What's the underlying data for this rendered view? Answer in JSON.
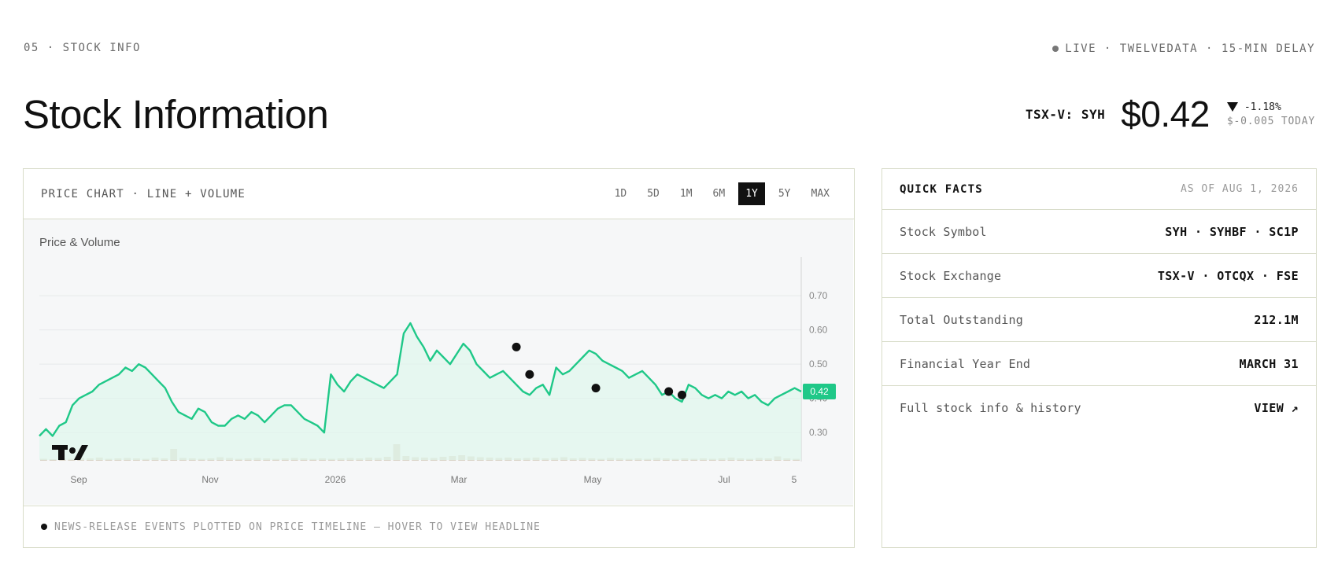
{
  "header": {
    "section_label": "05 · STOCK INFO",
    "live_status": "LIVE · TWELVEDATA · 15-MIN DELAY",
    "title": "Stock Information"
  },
  "quote": {
    "ticker": "TSX-V: SYH",
    "price": "$0.42",
    "change_pct": "-1.18%",
    "change_today": "$-0.005 TODAY"
  },
  "chart_panel": {
    "label": "PRICE CHART · LINE + VOLUME",
    "tabs": [
      "1D",
      "5D",
      "1M",
      "6M",
      "1Y",
      "5Y",
      "MAX"
    ],
    "active_tab": "1Y",
    "footer_note": "NEWS-RELEASE EVENTS PLOTTED ON PRICE TIMELINE — HOVER TO VIEW HEADLINE"
  },
  "chart_data": {
    "type": "line",
    "title": "Price & Volume",
    "x_ticks": [
      "Sep",
      "Nov",
      "2026",
      "Mar",
      "May",
      "Jul",
      "5"
    ],
    "y_ticks": [
      0.3,
      0.4,
      0.5,
      0.6,
      0.7
    ],
    "ylim": [
      0.22,
      0.79
    ],
    "last_price_label": "0.42",
    "series": [
      {
        "values": [
          0.29,
          0.31,
          0.29,
          0.32,
          0.33,
          0.38,
          0.4,
          0.41,
          0.42,
          0.44,
          0.45,
          0.46,
          0.47,
          0.49,
          0.48,
          0.5,
          0.49,
          0.47,
          0.45,
          0.43,
          0.39,
          0.36,
          0.35,
          0.34,
          0.37,
          0.36,
          0.33,
          0.32,
          0.32,
          0.34,
          0.35,
          0.34,
          0.36,
          0.35,
          0.33,
          0.35,
          0.37,
          0.38,
          0.38,
          0.36,
          0.34,
          0.33,
          0.32,
          0.3,
          0.47,
          0.44,
          0.42,
          0.45,
          0.47,
          0.46,
          0.45,
          0.44,
          0.43,
          0.45,
          0.47,
          0.59,
          0.62,
          0.58,
          0.55,
          0.51,
          0.54,
          0.52,
          0.5,
          0.53,
          0.56,
          0.54,
          0.5,
          0.48,
          0.46,
          0.47,
          0.48,
          0.46,
          0.44,
          0.42,
          0.41,
          0.43,
          0.44,
          0.41,
          0.49,
          0.47,
          0.48,
          0.5,
          0.52,
          0.54,
          0.53,
          0.51,
          0.5,
          0.49,
          0.48,
          0.46,
          0.47,
          0.48,
          0.46,
          0.44,
          0.41,
          0.42,
          0.4,
          0.39,
          0.44,
          0.43,
          0.41,
          0.4,
          0.41,
          0.4,
          0.42,
          0.41,
          0.42,
          0.4,
          0.41,
          0.39,
          0.38,
          0.4,
          0.41,
          0.42,
          0.43,
          0.42
        ]
      },
      {
        "name": "Volume",
        "values": [
          0.5,
          0.4,
          0.6,
          0.5,
          0.7,
          0.6,
          0.8,
          0.5,
          0.6,
          0.7,
          0.6,
          0.5,
          0.8,
          0.6,
          3.0,
          0.7,
          0.6,
          0.5,
          0.6,
          0.9,
          0.7,
          0.5,
          0.6,
          0.7,
          0.6,
          0.5,
          0.6,
          0.7,
          0.6,
          0.5,
          0.6,
          0.5,
          0.6,
          0.7,
          0.6,
          0.8,
          0.7,
          1.0,
          4.2,
          1.2,
          0.9,
          0.8,
          0.7,
          1.0,
          1.2,
          1.4,
          1.1,
          0.9,
          0.8,
          0.7,
          0.8,
          0.6,
          0.7,
          0.8,
          0.6,
          0.7,
          0.9,
          0.6,
          0.7,
          0.6,
          0.5,
          0.7,
          0.6,
          0.5,
          0.6,
          0.5,
          0.7,
          0.6,
          0.5,
          0.6,
          0.5,
          0.6,
          0.5,
          0.6,
          0.8,
          0.6,
          0.5,
          0.7,
          0.6,
          1.1,
          0.6,
          0.5
        ]
      }
    ],
    "events": [
      {
        "index": 72,
        "value": 0.55
      },
      {
        "index": 74,
        "value": 0.47
      },
      {
        "index": 84,
        "value": 0.43
      },
      {
        "index": 95,
        "value": 0.42
      },
      {
        "index": 97,
        "value": 0.41
      }
    ]
  },
  "quick_facts": {
    "title": "QUICK FACTS",
    "as_of": "AS OF AUG 1, 2026",
    "rows": [
      {
        "label": "Stock Symbol",
        "value": "SYH · SYHBF · SC1P"
      },
      {
        "label": "Stock Exchange",
        "value": "TSX-V · OTCQX · FSE"
      },
      {
        "label": "Total Outstanding",
        "value": "212.1M"
      },
      {
        "label": "Financial Year End",
        "value": "MARCH 31"
      }
    ],
    "link": {
      "label": "Full stock info & history",
      "value": "VIEW ↗"
    }
  },
  "colors": {
    "line": "#1fc888",
    "fill": "#dff6ec",
    "volume": "#d9d2c4",
    "border": "#d8dcc9",
    "badge": "#1fc888"
  }
}
